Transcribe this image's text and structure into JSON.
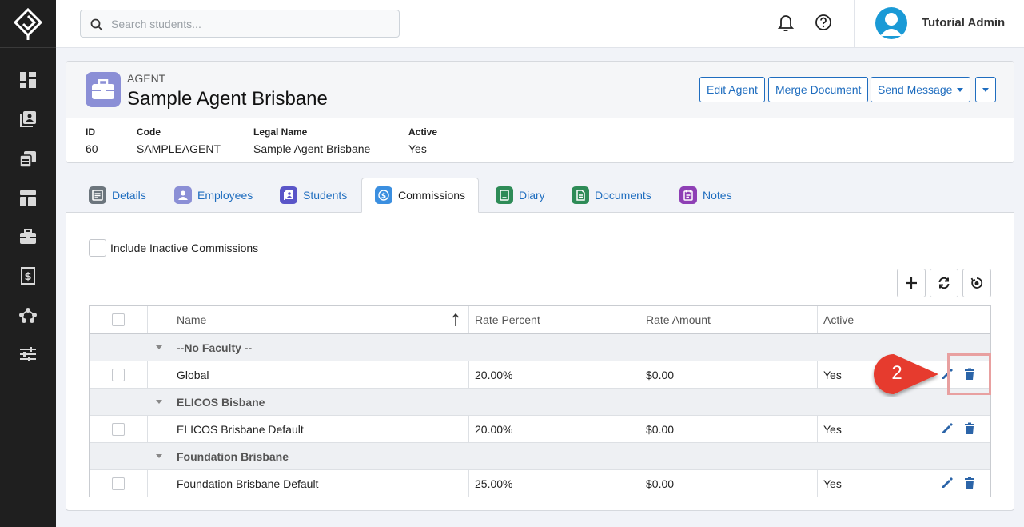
{
  "topbar": {
    "search_placeholder": "Search students...",
    "username": "Tutorial Admin"
  },
  "sidebar": {
    "items": [
      {
        "name": "dashboard-icon"
      },
      {
        "name": "students-icon"
      },
      {
        "name": "courses-icon"
      },
      {
        "name": "layout-icon"
      },
      {
        "name": "agents-icon"
      },
      {
        "name": "finance-icon"
      },
      {
        "name": "network-icon"
      },
      {
        "name": "settings-icon"
      }
    ]
  },
  "header": {
    "type_label": "AGENT",
    "title": "Sample Agent Brisbane",
    "buttons": {
      "edit": "Edit Agent",
      "merge": "Merge Document",
      "send": "Send Message"
    },
    "fields": [
      {
        "label": "ID",
        "value": "60"
      },
      {
        "label": "Code",
        "value": "SAMPLEAGENT"
      },
      {
        "label": "Legal Name",
        "value": "Sample Agent Brisbane"
      },
      {
        "label": "Active",
        "value": "Yes"
      }
    ]
  },
  "tabs": [
    {
      "label": "Details",
      "color": "#6c757d"
    },
    {
      "label": "Employees",
      "color": "#8b8fd6"
    },
    {
      "label": "Students",
      "color": "#5a55c8"
    },
    {
      "label": "Commissions",
      "color": "#3b8fe0"
    },
    {
      "label": "Diary",
      "color": "#2e8b57"
    },
    {
      "label": "Documents",
      "color": "#2e8b57"
    },
    {
      "label": "Notes",
      "color": "#8e3fb5"
    }
  ],
  "commissions": {
    "include_inactive_label": "Include Inactive Commissions",
    "columns": {
      "name": "Name",
      "rate_percent": "Rate Percent",
      "rate_amount": "Rate Amount",
      "active": "Active"
    },
    "groups": [
      {
        "label": "--No Faculty --",
        "rows": [
          {
            "name": "Global",
            "rate_percent": "20.00%",
            "rate_amount": "$0.00",
            "active": "Yes"
          }
        ]
      },
      {
        "label": "ELICOS Bisbane",
        "rows": [
          {
            "name": "ELICOS Brisbane Default",
            "rate_percent": "20.00%",
            "rate_amount": "$0.00",
            "active": "Yes"
          }
        ]
      },
      {
        "label": "Foundation Brisbane",
        "rows": [
          {
            "name": "Foundation Brisbane Default",
            "rate_percent": "25.00%",
            "rate_amount": "$0.00",
            "active": "Yes"
          }
        ]
      }
    ]
  },
  "annotation": {
    "step_number": "2",
    "callout_color": "#e63b2e"
  }
}
